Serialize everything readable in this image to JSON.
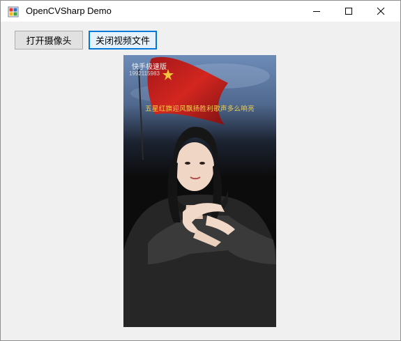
{
  "window": {
    "title": "OpenCVSharp Demo"
  },
  "toolbar": {
    "open_camera_label": "打开摄像头",
    "close_video_label": "关闭视频文件"
  },
  "video": {
    "watermark_app": "快手极速版",
    "watermark_id": "1992115983",
    "subtitle": "五星红旗迎风飘扬胜利歌声多么响亮"
  },
  "colors": {
    "focus_border": "#0078d7",
    "subtitle": "#f2d24a",
    "flag_red": "#c81e1e",
    "window_bg": "#f0f0f0"
  }
}
